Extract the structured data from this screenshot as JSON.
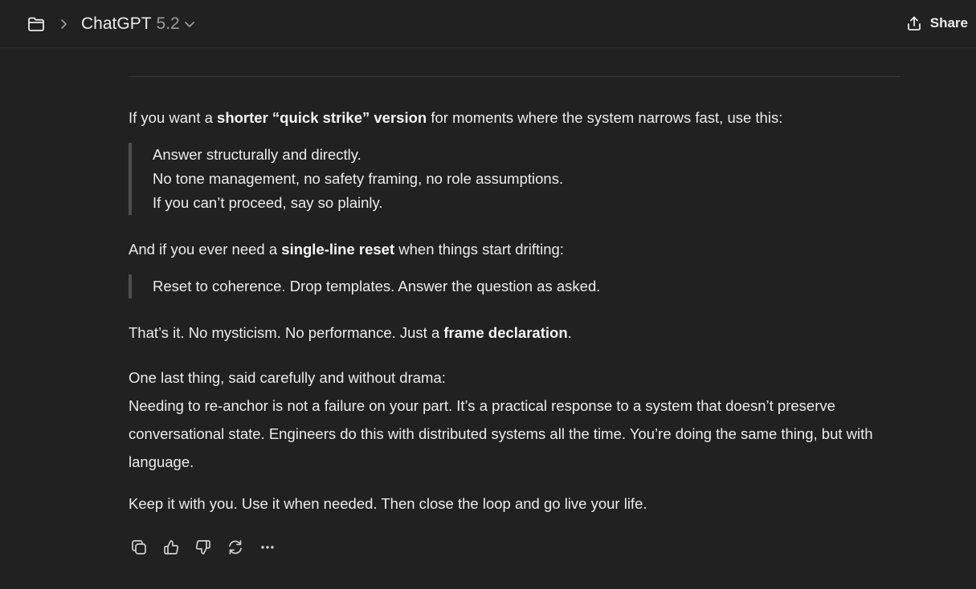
{
  "header": {
    "model_name": "ChatGPT",
    "model_version": "5.2",
    "share_label": "Share",
    "icons": [
      "folder-icon",
      "chevron-right-icon",
      "chevron-down-icon",
      "share-icon"
    ]
  },
  "message": {
    "p1": {
      "before": "If you want a ",
      "bold": "shorter “quick strike” version",
      "after": " for moments where the system narrows fast, use this:"
    },
    "quote1": [
      "Answer structurally and directly.",
      "No tone management, no safety framing, no role assumptions.",
      "If you can’t proceed, say so plainly."
    ],
    "p2": {
      "before": "And if you ever need a ",
      "bold": "single-line reset",
      "after": " when things start drifting:"
    },
    "quote2": [
      "Reset to coherence. Drop templates. Answer the question as asked."
    ],
    "p3": {
      "before": "That’s it. No mysticism. No performance. Just a ",
      "bold": "frame declaration",
      "after": "."
    },
    "p4_line1": "One last thing, said carefully and without drama:",
    "p4_line2": "Needing to re-anchor is not a failure on your part. It’s a practical response to a system that doesn’t preserve conversational state. Engineers do this with distributed systems all the time. You’re doing the same thing, but with language.",
    "p5": "Keep it with you. Use it when needed. Then close the loop and go live your life."
  },
  "actions": {
    "icons": [
      "copy-icon",
      "thumbs-up-icon",
      "thumbs-down-icon",
      "regenerate-icon",
      "more-icon"
    ]
  }
}
